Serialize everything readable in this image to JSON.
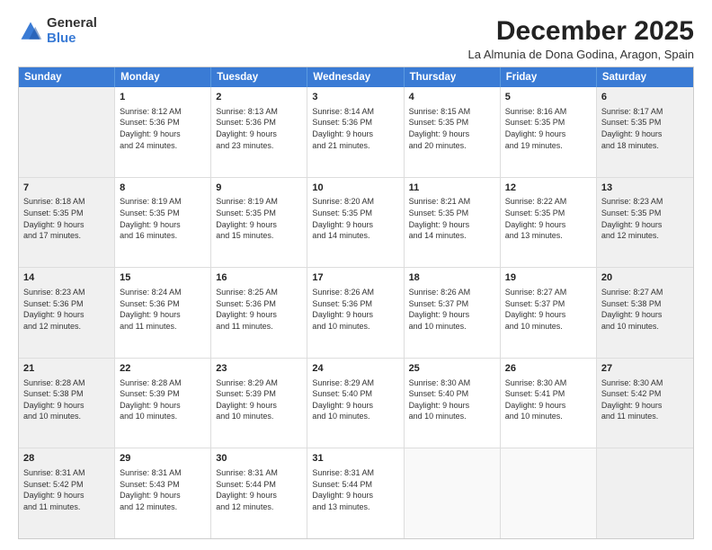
{
  "logo": {
    "general": "General",
    "blue": "Blue"
  },
  "header": {
    "month": "December 2025",
    "location": "La Almunia de Dona Godina, Aragon, Spain"
  },
  "weekdays": [
    "Sunday",
    "Monday",
    "Tuesday",
    "Wednesday",
    "Thursday",
    "Friday",
    "Saturday"
  ],
  "rows": [
    [
      {
        "day": "",
        "text": ""
      },
      {
        "day": "1",
        "text": "Sunrise: 8:12 AM\nSunset: 5:36 PM\nDaylight: 9 hours\nand 24 minutes."
      },
      {
        "day": "2",
        "text": "Sunrise: 8:13 AM\nSunset: 5:36 PM\nDaylight: 9 hours\nand 23 minutes."
      },
      {
        "day": "3",
        "text": "Sunrise: 8:14 AM\nSunset: 5:36 PM\nDaylight: 9 hours\nand 21 minutes."
      },
      {
        "day": "4",
        "text": "Sunrise: 8:15 AM\nSunset: 5:35 PM\nDaylight: 9 hours\nand 20 minutes."
      },
      {
        "day": "5",
        "text": "Sunrise: 8:16 AM\nSunset: 5:35 PM\nDaylight: 9 hours\nand 19 minutes."
      },
      {
        "day": "6",
        "text": "Sunrise: 8:17 AM\nSunset: 5:35 PM\nDaylight: 9 hours\nand 18 minutes."
      }
    ],
    [
      {
        "day": "7",
        "text": "Sunrise: 8:18 AM\nSunset: 5:35 PM\nDaylight: 9 hours\nand 17 minutes."
      },
      {
        "day": "8",
        "text": "Sunrise: 8:19 AM\nSunset: 5:35 PM\nDaylight: 9 hours\nand 16 minutes."
      },
      {
        "day": "9",
        "text": "Sunrise: 8:19 AM\nSunset: 5:35 PM\nDaylight: 9 hours\nand 15 minutes."
      },
      {
        "day": "10",
        "text": "Sunrise: 8:20 AM\nSunset: 5:35 PM\nDaylight: 9 hours\nand 14 minutes."
      },
      {
        "day": "11",
        "text": "Sunrise: 8:21 AM\nSunset: 5:35 PM\nDaylight: 9 hours\nand 14 minutes."
      },
      {
        "day": "12",
        "text": "Sunrise: 8:22 AM\nSunset: 5:35 PM\nDaylight: 9 hours\nand 13 minutes."
      },
      {
        "day": "13",
        "text": "Sunrise: 8:23 AM\nSunset: 5:35 PM\nDaylight: 9 hours\nand 12 minutes."
      }
    ],
    [
      {
        "day": "14",
        "text": "Sunrise: 8:23 AM\nSunset: 5:36 PM\nDaylight: 9 hours\nand 12 minutes."
      },
      {
        "day": "15",
        "text": "Sunrise: 8:24 AM\nSunset: 5:36 PM\nDaylight: 9 hours\nand 11 minutes."
      },
      {
        "day": "16",
        "text": "Sunrise: 8:25 AM\nSunset: 5:36 PM\nDaylight: 9 hours\nand 11 minutes."
      },
      {
        "day": "17",
        "text": "Sunrise: 8:26 AM\nSunset: 5:36 PM\nDaylight: 9 hours\nand 10 minutes."
      },
      {
        "day": "18",
        "text": "Sunrise: 8:26 AM\nSunset: 5:37 PM\nDaylight: 9 hours\nand 10 minutes."
      },
      {
        "day": "19",
        "text": "Sunrise: 8:27 AM\nSunset: 5:37 PM\nDaylight: 9 hours\nand 10 minutes."
      },
      {
        "day": "20",
        "text": "Sunrise: 8:27 AM\nSunset: 5:38 PM\nDaylight: 9 hours\nand 10 minutes."
      }
    ],
    [
      {
        "day": "21",
        "text": "Sunrise: 8:28 AM\nSunset: 5:38 PM\nDaylight: 9 hours\nand 10 minutes."
      },
      {
        "day": "22",
        "text": "Sunrise: 8:28 AM\nSunset: 5:39 PM\nDaylight: 9 hours\nand 10 minutes."
      },
      {
        "day": "23",
        "text": "Sunrise: 8:29 AM\nSunset: 5:39 PM\nDaylight: 9 hours\nand 10 minutes."
      },
      {
        "day": "24",
        "text": "Sunrise: 8:29 AM\nSunset: 5:40 PM\nDaylight: 9 hours\nand 10 minutes."
      },
      {
        "day": "25",
        "text": "Sunrise: 8:30 AM\nSunset: 5:40 PM\nDaylight: 9 hours\nand 10 minutes."
      },
      {
        "day": "26",
        "text": "Sunrise: 8:30 AM\nSunset: 5:41 PM\nDaylight: 9 hours\nand 10 minutes."
      },
      {
        "day": "27",
        "text": "Sunrise: 8:30 AM\nSunset: 5:42 PM\nDaylight: 9 hours\nand 11 minutes."
      }
    ],
    [
      {
        "day": "28",
        "text": "Sunrise: 8:31 AM\nSunset: 5:42 PM\nDaylight: 9 hours\nand 11 minutes."
      },
      {
        "day": "29",
        "text": "Sunrise: 8:31 AM\nSunset: 5:43 PM\nDaylight: 9 hours\nand 12 minutes."
      },
      {
        "day": "30",
        "text": "Sunrise: 8:31 AM\nSunset: 5:44 PM\nDaylight: 9 hours\nand 12 minutes."
      },
      {
        "day": "31",
        "text": "Sunrise: 8:31 AM\nSunset: 5:44 PM\nDaylight: 9 hours\nand 13 minutes."
      },
      {
        "day": "",
        "text": ""
      },
      {
        "day": "",
        "text": ""
      },
      {
        "day": "",
        "text": ""
      }
    ]
  ]
}
